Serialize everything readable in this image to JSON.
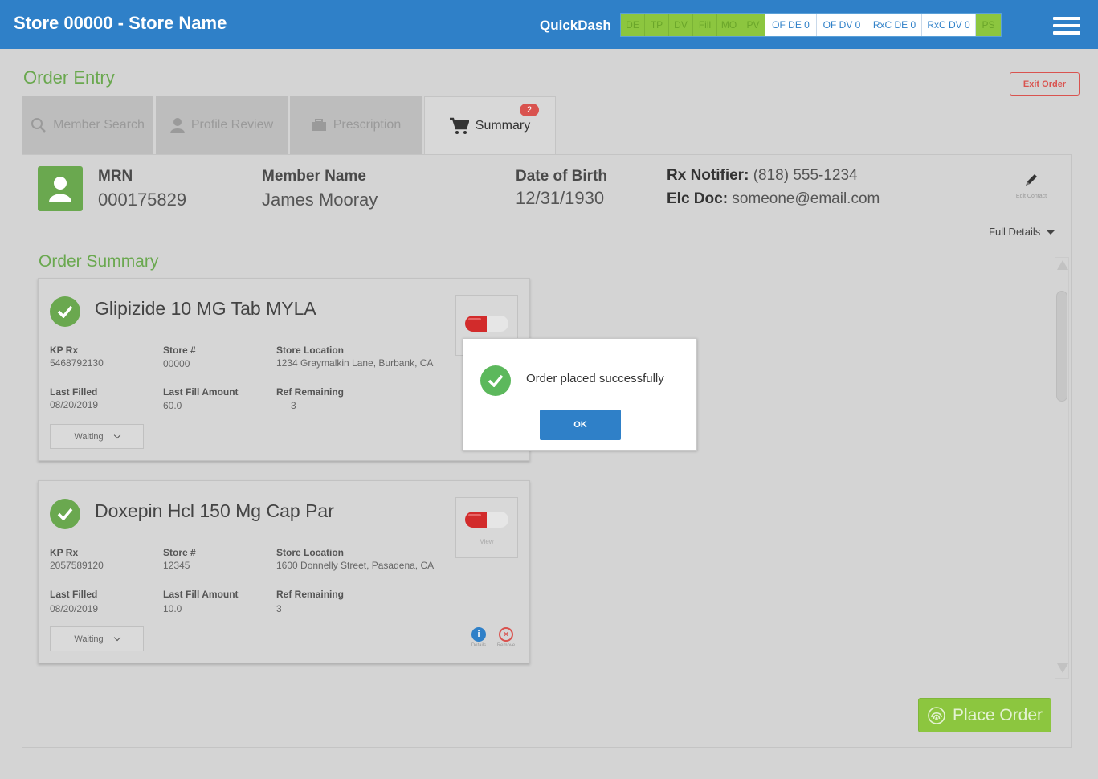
{
  "header": {
    "store_title": "Store 00000 - Store Name",
    "quickdash_label": "QuickDash",
    "quickdash_cells": [
      "DE",
      "TP",
      "DV",
      "Fill",
      "MO",
      "PV"
    ],
    "quickdash_counts": [
      "OF DE 0",
      "OF DV 0",
      "RxC DE 0",
      "RxC DV 0"
    ],
    "quickdash_last": "PS"
  },
  "page": {
    "title": "Order Entry",
    "exit_label": "Exit Order"
  },
  "tabs": [
    {
      "label": "Member Search",
      "icon": "search-icon"
    },
    {
      "label": "Profile Review",
      "icon": "user-icon"
    },
    {
      "label": "Prescription",
      "icon": "briefcase-icon"
    },
    {
      "label": "Summary",
      "icon": "cart-icon",
      "badge": "2",
      "active": true
    }
  ],
  "member": {
    "mrn_label": "MRN",
    "mrn": "000175829",
    "name_label": "Member Name",
    "name": "James Mooray",
    "dob_label": "Date of Birth",
    "dob": "12/31/1930",
    "rx_notifier_label": "Rx Notifier:",
    "rx_notifier": "(818) 555-1234",
    "elc_doc_label": "Elc Doc:",
    "elc_doc": "someone@email.com",
    "edit_contact_label": "Edit Contact"
  },
  "full_details_label": "Full Details",
  "order_summary_title": "Order Summary",
  "orders": [
    {
      "drug": "Glipizide 10 MG Tab MYLA",
      "kp_rx_label": "KP Rx",
      "kp_rx": "5468792130",
      "store_label": "Store #",
      "store": "00000",
      "location_label": "Store Location",
      "location": "1234 Graymalkin Lane, Burbank, CA",
      "last_filled_label": "Last Filled",
      "last_filled": "08/20/2019",
      "last_fill_amount_label": "Last Fill Amount",
      "last_fill_amount": "60.0",
      "ref_remaining_label": "Ref Remaining",
      "ref_remaining": "3",
      "status": "Waiting"
    },
    {
      "drug": "Doxepin Hcl 150 Mg Cap Par",
      "kp_rx_label": "KP Rx",
      "kp_rx": "2057589120",
      "store_label": "Store #",
      "store": "12345",
      "location_label": "Store Location",
      "location": "1600 Donnelly Street, Pasadena, CA",
      "last_filled_label": "Last Filled",
      "last_filled": "08/20/2019",
      "last_fill_amount_label": "Last Fill Amount",
      "last_fill_amount": "10.0",
      "ref_remaining_label": "Ref Remaining",
      "ref_remaining": "3",
      "status": "Waiting",
      "view_label": "View",
      "details_label": "Details",
      "remove_label": "Remove"
    }
  ],
  "place_order_label": "Place Order",
  "modal": {
    "message": "Order placed successfully",
    "ok_label": "OK"
  },
  "colors": {
    "header_blue": "#2f80c8",
    "accent_green": "#6aa84f",
    "quickdash_green": "#8cc63f",
    "danger_red": "#d9534f"
  }
}
